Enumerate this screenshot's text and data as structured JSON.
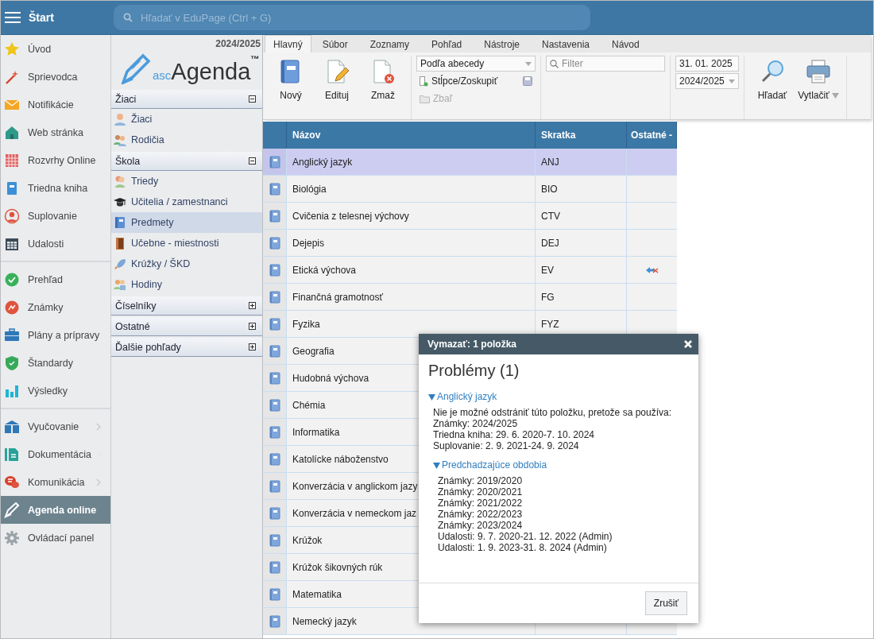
{
  "top_bar": {
    "title": "Štart",
    "search": {
      "placeholder": "Hľadať v EduPage (Ctrl + G)"
    }
  },
  "sidebar": {
    "groups": [
      {
        "items": [
          {
            "label": "Úvod",
            "selected": false,
            "submenu": false
          },
          {
            "label": "Sprievodca",
            "selected": false,
            "submenu": false
          },
          {
            "label": "Notifikácie",
            "selected": false,
            "submenu": false
          },
          {
            "label": "Web stránka",
            "selected": false,
            "submenu": false
          },
          {
            "label": "Rozvrhy Online",
            "selected": false,
            "submenu": false
          },
          {
            "label": "Triedna kniha",
            "selected": false,
            "submenu": false
          },
          {
            "label": "Suplovanie",
            "selected": false,
            "submenu": false
          },
          {
            "label": "Udalosti",
            "selected": false,
            "submenu": false
          }
        ]
      },
      {
        "items": [
          {
            "label": "Prehľad",
            "selected": false,
            "submenu": false
          },
          {
            "label": "Známky",
            "selected": false,
            "submenu": false
          },
          {
            "label": "Plány a prípravy",
            "selected": false,
            "submenu": false
          },
          {
            "label": "Štandardy",
            "selected": false,
            "submenu": false
          },
          {
            "label": "Výsledky",
            "selected": false,
            "submenu": false
          }
        ]
      },
      {
        "items": [
          {
            "label": "Vyučovanie",
            "selected": false,
            "submenu": true
          },
          {
            "label": "Dokumentácia",
            "selected": false,
            "submenu": true
          },
          {
            "label": "Komunikácia",
            "selected": false,
            "submenu": true
          },
          {
            "label": "Agenda online",
            "selected": true,
            "submenu": false
          },
          {
            "label": "Ovládací panel",
            "selected": false,
            "submenu": false
          }
        ]
      }
    ]
  },
  "agenda_panel": {
    "year": "2024/2025",
    "logo": {
      "prefix": "asc",
      "name": "Agenda",
      "mark": "™"
    },
    "sections": [
      {
        "title": "Žiaci",
        "expanded": true,
        "items": [
          {
            "label": "Žiaci",
            "selected": false
          },
          {
            "label": "Rodičia",
            "selected": false
          }
        ]
      },
      {
        "title": "Škola",
        "expanded": true,
        "items": [
          {
            "label": "Triedy",
            "selected": false
          },
          {
            "label": "Učitelia / zamestnanci",
            "selected": false
          },
          {
            "label": "Predmety",
            "selected": true
          },
          {
            "label": "Učebne - miestnosti",
            "selected": false
          },
          {
            "label": "Krúžky / ŠKD",
            "selected": false
          },
          {
            "label": "Hodiny",
            "selected": false
          }
        ]
      },
      {
        "title": "Číselníky",
        "expanded": false
      },
      {
        "title": "Ostatné",
        "expanded": false
      },
      {
        "title": "Ďalšie pohľady",
        "expanded": false
      }
    ]
  },
  "ribbon": {
    "tabs": [
      {
        "label": "Hlavný",
        "selected": true
      },
      {
        "label": "Súbor",
        "selected": false
      },
      {
        "label": "Zoznamy",
        "selected": false
      },
      {
        "label": "Pohľad",
        "selected": false
      },
      {
        "label": "Nástroje",
        "selected": false
      },
      {
        "label": "Nastavenia",
        "selected": false
      },
      {
        "label": "Návod",
        "selected": false
      }
    ],
    "actions": [
      {
        "label": "Nový"
      },
      {
        "label": "Edituj"
      },
      {
        "label": "Zmaž"
      }
    ],
    "sort_select": {
      "value": "Podľa abecedy"
    },
    "columns_link": {
      "label": "Stĺpce/Zoskupiť"
    },
    "collapse_link": {
      "label": "Zbaľ",
      "disabled": true
    },
    "filter": {
      "placeholder": "Filter"
    },
    "date": {
      "value": "31. 01. 2025"
    },
    "year_select": {
      "value": "2024/2025"
    },
    "tools": [
      {
        "label": "Hľadať",
        "dropdown": false
      },
      {
        "label": "Vytlačiť",
        "dropdown": true
      }
    ]
  },
  "table": {
    "columns": [
      "Názov",
      "Skratka",
      "Ostatné -"
    ],
    "rows": [
      {
        "name": "Anglický jazyk",
        "code": "ANJ",
        "selected": true,
        "linked": false
      },
      {
        "name": "Biológia",
        "code": "BIO",
        "selected": false,
        "linked": false
      },
      {
        "name": "Cvičenia z telesnej výchovy",
        "code": "CTV",
        "selected": false,
        "linked": false
      },
      {
        "name": "Dejepis",
        "code": "DEJ",
        "selected": false,
        "linked": false
      },
      {
        "name": "Etická výchova",
        "code": "EV",
        "selected": false,
        "linked": true
      },
      {
        "name": "Finančná gramotnosť",
        "code": "FG",
        "selected": false,
        "linked": false
      },
      {
        "name": "Fyzika",
        "code": "FYZ",
        "selected": false,
        "linked": false
      },
      {
        "name": "Geografia",
        "selected": false,
        "linked": false
      },
      {
        "name": "Hudobná výchova",
        "selected": false,
        "linked": false
      },
      {
        "name": "Chémia",
        "selected": false,
        "linked": false
      },
      {
        "name": "Informatika",
        "selected": false,
        "linked": false
      },
      {
        "name": "Katolícke náboženstvo",
        "selected": false,
        "linked": false
      },
      {
        "name": "Konverzácia v anglickom jazy",
        "selected": false,
        "linked": false
      },
      {
        "name": "Konverzácia v nemeckom jaz",
        "selected": false,
        "linked": false
      },
      {
        "name": "Krúžok",
        "selected": false,
        "linked": false
      },
      {
        "name": "Krúžok šikovných rúk",
        "selected": false,
        "linked": false
      },
      {
        "name": "Matematika",
        "selected": false,
        "linked": false
      },
      {
        "name": "Nemecký jazyk",
        "selected": false,
        "linked": false
      }
    ]
  },
  "dialog": {
    "title": "Vymazať: 1 položka",
    "heading": "Problémy (1)",
    "group": {
      "title": "Anglický jazyk",
      "expanded": true,
      "lines": [
        "Nie je možné odstrániť túto položku, pretože sa používa:",
        "Známky: 2024/2025",
        "Triedna kniha: 29. 6. 2020-7. 10. 2024",
        "Suplovanie: 2. 9. 2021-24. 9. 2024"
      ],
      "subgroup": {
        "title": "Predchadzajúce obdobia",
        "expanded": true,
        "lines": [
          "Známky: 2019/2020",
          "Známky: 2020/2021",
          "Známky: 2021/2022",
          "Známky: 2022/2023",
          "Známky: 2023/2024",
          "Udalosti: 9. 7. 2020-21. 12. 2022 (Admin)",
          "Udalosti: 1. 9. 2023-31. 8. 2024 (Admin)"
        ]
      }
    },
    "buttons": [
      "Zrušiť"
    ]
  }
}
